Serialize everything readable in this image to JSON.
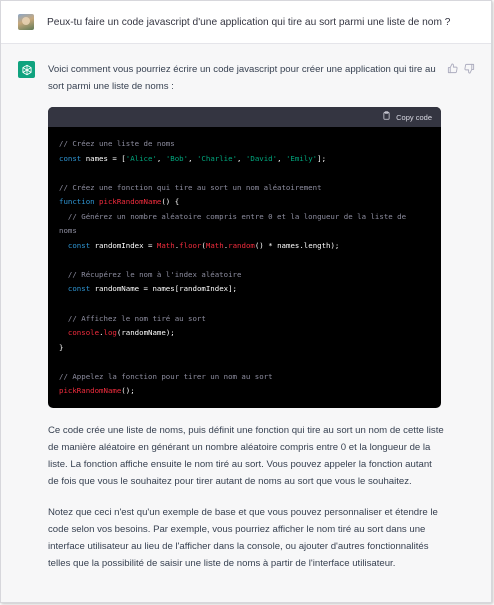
{
  "user_message": {
    "text": "Peux-tu faire un code javascript d'une application qui tire au sort parmi une liste de nom ?"
  },
  "assistant": {
    "intro": "Voici comment vous pourriez écrire un code javascript pour créer une application qui tire au sort parmi une liste de noms :",
    "code_block": {
      "copy_label": "Copy code",
      "lines": [
        [
          {
            "t": "// Créez une liste de noms",
            "c": "com"
          }
        ],
        [
          {
            "t": "const ",
            "c": "kw"
          },
          {
            "t": "names = [",
            "c": "plain"
          },
          {
            "t": "'Alice'",
            "c": "str"
          },
          {
            "t": ", ",
            "c": "plain"
          },
          {
            "t": "'Bob'",
            "c": "str"
          },
          {
            "t": ", ",
            "c": "plain"
          },
          {
            "t": "'Charlie'",
            "c": "str"
          },
          {
            "t": ", ",
            "c": "plain"
          },
          {
            "t": "'David'",
            "c": "str"
          },
          {
            "t": ", ",
            "c": "plain"
          },
          {
            "t": "'Emily'",
            "c": "str"
          },
          {
            "t": "];",
            "c": "plain"
          }
        ],
        [],
        [
          {
            "t": "// Créez une fonction qui tire au sort un nom aléatoirement",
            "c": "com"
          }
        ],
        [
          {
            "t": "function ",
            "c": "kw"
          },
          {
            "t": "pickRandomName",
            "c": "fn"
          },
          {
            "t": "() {",
            "c": "plain"
          }
        ],
        [
          {
            "t": "  // Générez un nombre aléatoire compris entre 0 et la longueur de la liste de",
            "c": "com"
          }
        ],
        [
          {
            "t": "noms",
            "c": "com"
          }
        ],
        [
          {
            "t": "  ",
            "c": "plain"
          },
          {
            "t": "const ",
            "c": "kw"
          },
          {
            "t": "randomIndex = ",
            "c": "plain"
          },
          {
            "t": "Math",
            "c": "fn"
          },
          {
            "t": ".",
            "c": "plain"
          },
          {
            "t": "floor",
            "c": "fn"
          },
          {
            "t": "(",
            "c": "plain"
          },
          {
            "t": "Math",
            "c": "fn"
          },
          {
            "t": ".",
            "c": "plain"
          },
          {
            "t": "random",
            "c": "fn"
          },
          {
            "t": "() * names.length);",
            "c": "plain"
          }
        ],
        [],
        [
          {
            "t": "  // Récupérez le nom à l'index aléatoire",
            "c": "com"
          }
        ],
        [
          {
            "t": "  ",
            "c": "plain"
          },
          {
            "t": "const ",
            "c": "kw"
          },
          {
            "t": "randomName = names[randomIndex];",
            "c": "plain"
          }
        ],
        [],
        [
          {
            "t": "  // Affichez le nom tiré au sort",
            "c": "com"
          }
        ],
        [
          {
            "t": "  ",
            "c": "plain"
          },
          {
            "t": "console",
            "c": "fn"
          },
          {
            "t": ".",
            "c": "plain"
          },
          {
            "t": "log",
            "c": "fn"
          },
          {
            "t": "(randomName);",
            "c": "plain"
          }
        ],
        [
          {
            "t": "}",
            "c": "plain"
          }
        ],
        [],
        [
          {
            "t": "// Appelez la fonction pour tirer un nom au sort",
            "c": "com"
          }
        ],
        [
          {
            "t": "pickRandomName",
            "c": "fn"
          },
          {
            "t": "();",
            "c": "plain"
          }
        ]
      ]
    },
    "paragraph_1": "Ce code crée une liste de noms, puis définit une fonction qui tire au sort un nom de cette liste de manière aléatoire en générant un nombre aléatoire compris entre 0 et la longueur de la liste. La fonction affiche ensuite le nom tiré au sort. Vous pouvez appeler la fonction autant de fois que vous le souhaitez pour tirer autant de noms au sort que vous le souhaitez.",
    "paragraph_2": "Notez que ceci n'est qu'un exemple de base et que vous pouvez personnaliser et étendre le code selon vos besoins. Par exemple, vous pourriez afficher le nom tiré au sort dans une interface utilisateur au lieu de l'afficher dans la console, ou ajouter d'autres fonctionnalités telles que la possibilité de saisir une liste de noms à partir de l'interface utilisateur."
  },
  "colors": {
    "assistant_avatar": "#10a37f",
    "code_background": "#000000",
    "code_header": "#343541",
    "comment": "#8e8ea0",
    "keyword": "#2e95d3",
    "string": "#00a67d",
    "function": "#f22c3d"
  },
  "icons": {
    "assistant_avatar": "openai-logo-icon",
    "thumbs_up": "thumbs-up-icon",
    "thumbs_down": "thumbs-down-icon",
    "copy": "clipboard-icon"
  }
}
